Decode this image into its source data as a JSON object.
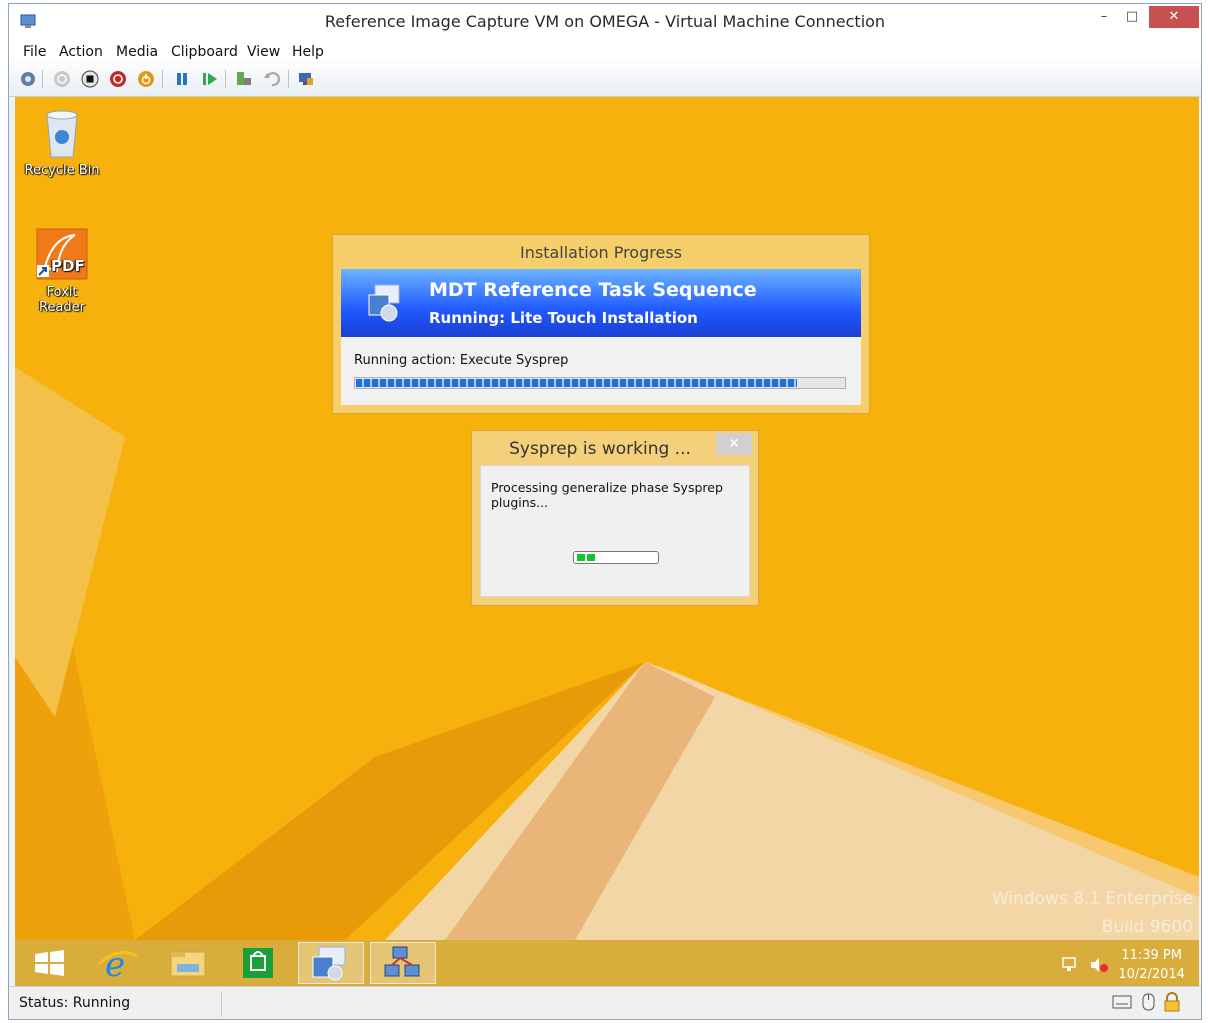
{
  "window": {
    "title": "Reference Image Capture VM on OMEGA - Virtual Machine Connection",
    "minimize_glyph": "–",
    "maximize_glyph": "□",
    "close_glyph": "✕"
  },
  "menu": {
    "items": [
      "File",
      "Action",
      "Media",
      "Clipboard",
      "View",
      "Help"
    ]
  },
  "toolbar": {
    "icons": [
      "ctrl-alt-del-icon",
      "start-icon",
      "turn-off-icon",
      "shut-down-icon",
      "save-icon",
      "pause-icon",
      "reset-icon",
      "checkpoint-icon",
      "revert-icon",
      "enhanced-session-icon"
    ]
  },
  "desktop": {
    "icons": [
      {
        "label": "Recycle Bin",
        "icon": "recycle-bin-icon"
      },
      {
        "label": "Foxit Reader",
        "icon": "pdf-icon"
      }
    ],
    "watermark_line1": "Windows 8.1 Enterprise",
    "watermark_line2": "Build 9600"
  },
  "installation_dialog": {
    "title": "Installation Progress",
    "heading": "MDT Reference Task Sequence",
    "subheading": "Running: Lite Touch Installation",
    "action": "Running action: Execute Sysprep",
    "progress": 0.9
  },
  "sysprep_dialog": {
    "title": "Sysprep is working ...",
    "close_glyph": "✕",
    "message": "Processing generalize phase Sysprep plugins...",
    "progress_style": "marquee"
  },
  "taskbar": {
    "apps": [
      "start-icon",
      "internet-explorer-icon",
      "file-explorer-icon",
      "store-icon",
      "mdt-task-sequence-icon",
      "network-app-icon"
    ],
    "time": "11:39 PM",
    "date": "10/2/2014"
  },
  "status": {
    "text": "Status: Running"
  },
  "colors": {
    "desktop_bg": "#f7b10d",
    "banner_blue": "#2159ff",
    "close_red": "#c75050",
    "sysprep_progress": "#16c22e"
  }
}
